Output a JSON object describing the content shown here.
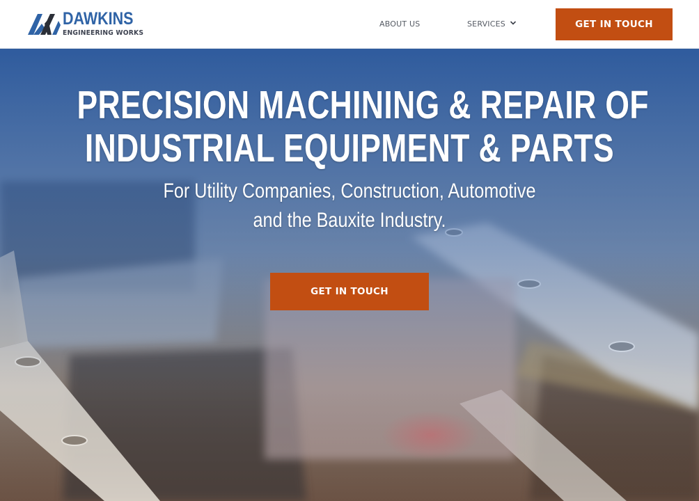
{
  "header": {
    "logo": {
      "name": "DAWKINS",
      "tagline": "ENGINEERING WORKS",
      "icon": "dn-monogram-logo"
    },
    "nav": {
      "about_label": "ABOUT US",
      "services_label": "SERVICES",
      "services_icon": "chevron-down-icon"
    },
    "cta_label": "GET IN TOUCH"
  },
  "hero": {
    "title_lines": [
      "PRECISION MACHINING & REPAIR OF",
      "INDUSTRIAL EQUIPMENT & PARTS"
    ],
    "subtitle_lines": [
      "For Utility Companies, Construction, Automotive",
      "and the Bauxite Industry."
    ],
    "cta_label": "GET IN TOUCH",
    "background": "industrial-machining-photo"
  },
  "colors": {
    "brand_blue": "#2f63a6",
    "accent_orange": "#c24e12",
    "hero_overlay": "#2e5c9c",
    "nav_text": "#555a63"
  }
}
